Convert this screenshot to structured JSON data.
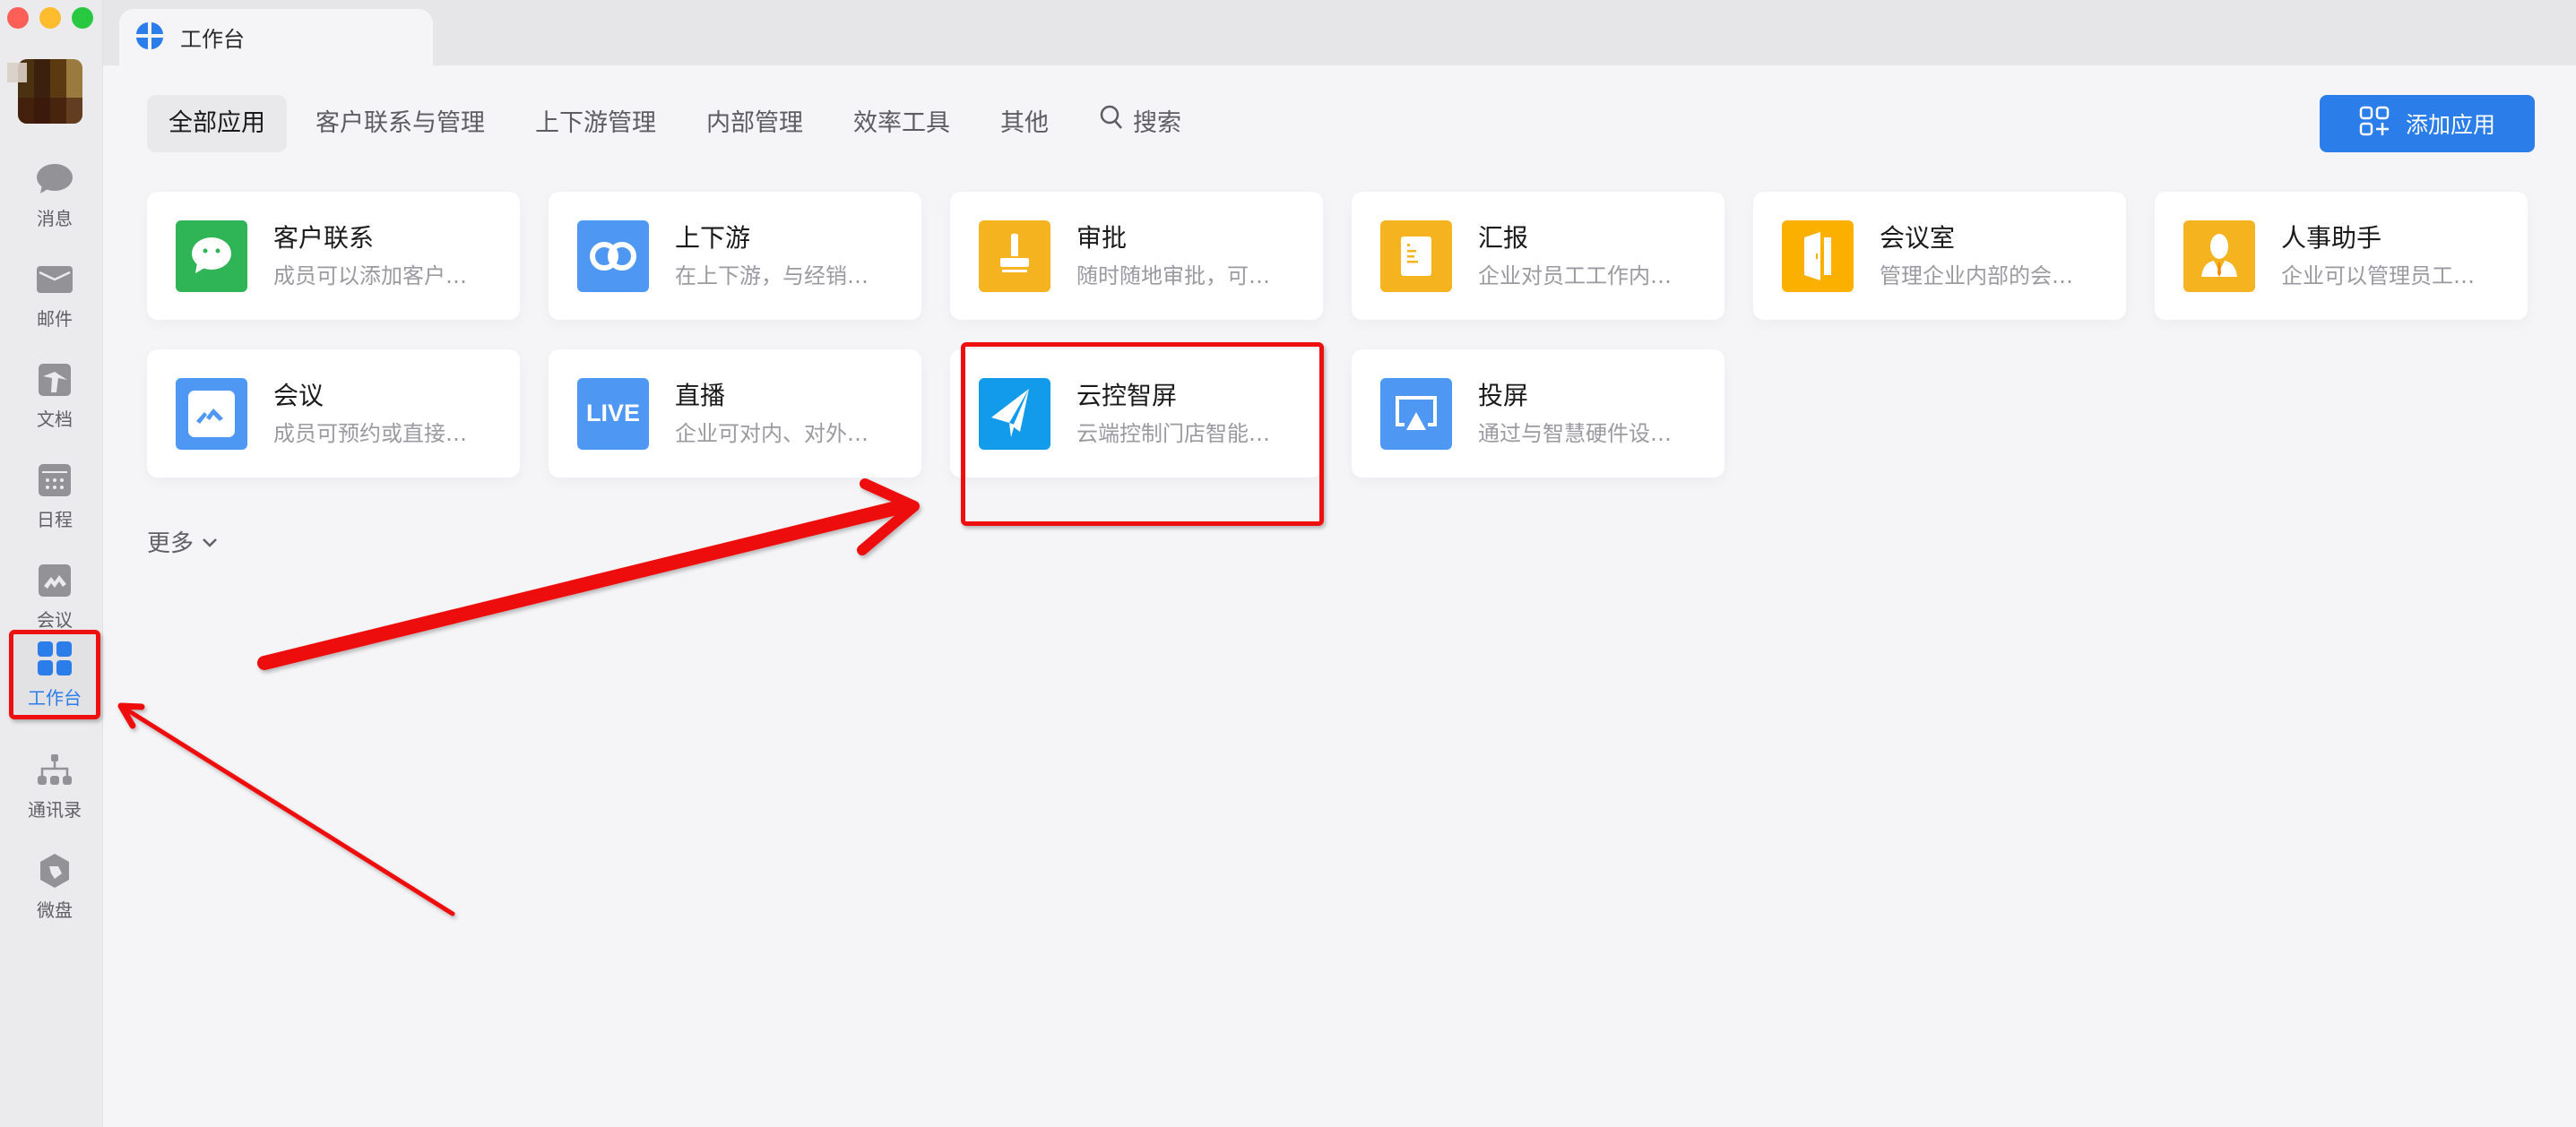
{
  "window": {
    "traffic_lights": [
      "close",
      "minimize",
      "maximize"
    ]
  },
  "tab": {
    "title": "工作台",
    "icon": "workbench-logo-icon"
  },
  "sidebar": {
    "items": [
      {
        "label": "消息",
        "icon": "message-bubble-icon",
        "active": false
      },
      {
        "label": "邮件",
        "icon": "mail-envelope-icon",
        "active": false
      },
      {
        "label": "文档",
        "icon": "document-icon",
        "active": false
      },
      {
        "label": "日程",
        "icon": "calendar-icon",
        "active": false
      },
      {
        "label": "会议",
        "icon": "meeting-icon",
        "active": false
      },
      {
        "label": "工作台",
        "icon": "workbench-grid-icon",
        "active": true
      },
      {
        "label": "通讯录",
        "icon": "org-chart-icon",
        "active": false
      },
      {
        "label": "微盘",
        "icon": "drive-icon",
        "active": false
      }
    ]
  },
  "nav": {
    "tabs": [
      {
        "label": "全部应用",
        "active": true
      },
      {
        "label": "客户联系与管理",
        "active": false
      },
      {
        "label": "上下游管理",
        "active": false
      },
      {
        "label": "内部管理",
        "active": false
      },
      {
        "label": "效率工具",
        "active": false
      },
      {
        "label": "其他",
        "active": false
      }
    ],
    "search_label": "搜索"
  },
  "add_app_button": {
    "label": "添加应用",
    "color": "#2b7de9"
  },
  "apps": [
    {
      "title": "客户联系",
      "desc": "成员可以添加客户…",
      "icon": "chat-bubble-icon",
      "color": "#2fb456"
    },
    {
      "title": "上下游",
      "desc": "在上下游，与经销…",
      "icon": "link-rings-icon",
      "color": "#4e97f2"
    },
    {
      "title": "审批",
      "desc": "随时随地审批，可…",
      "icon": "stamp-icon",
      "color": "#f5b320"
    },
    {
      "title": "汇报",
      "desc": "企业对员工工作内…",
      "icon": "report-sheet-icon",
      "color": "#f5b320"
    },
    {
      "title": "会议室",
      "desc": "管理企业内部的会…",
      "icon": "door-icon",
      "color": "#fbb000"
    },
    {
      "title": "人事助手",
      "desc": "企业可以管理员工…",
      "icon": "person-tie-icon",
      "color": "#f5b320"
    },
    {
      "title": "会议",
      "desc": "成员可预约或直接…",
      "icon": "meeting-app-icon",
      "color": "#4e97f2"
    },
    {
      "title": "直播",
      "desc": "企业可对内、对外…",
      "icon": "live-icon",
      "color": "#4e97f2",
      "icon_text": "LIVE"
    },
    {
      "title": "云控智屏",
      "desc": "云端控制门店智能…",
      "icon": "paper-plane-icon",
      "color": "#129bea"
    },
    {
      "title": "投屏",
      "desc": "通过与智慧硬件设…",
      "icon": "screen-cast-icon",
      "color": "#4e97f2"
    }
  ],
  "more": {
    "label": "更多"
  },
  "annotations": {
    "color": "#ee0f0f",
    "highlighted_app": "云控智屏",
    "highlighted_sidebar_item": "工作台"
  }
}
